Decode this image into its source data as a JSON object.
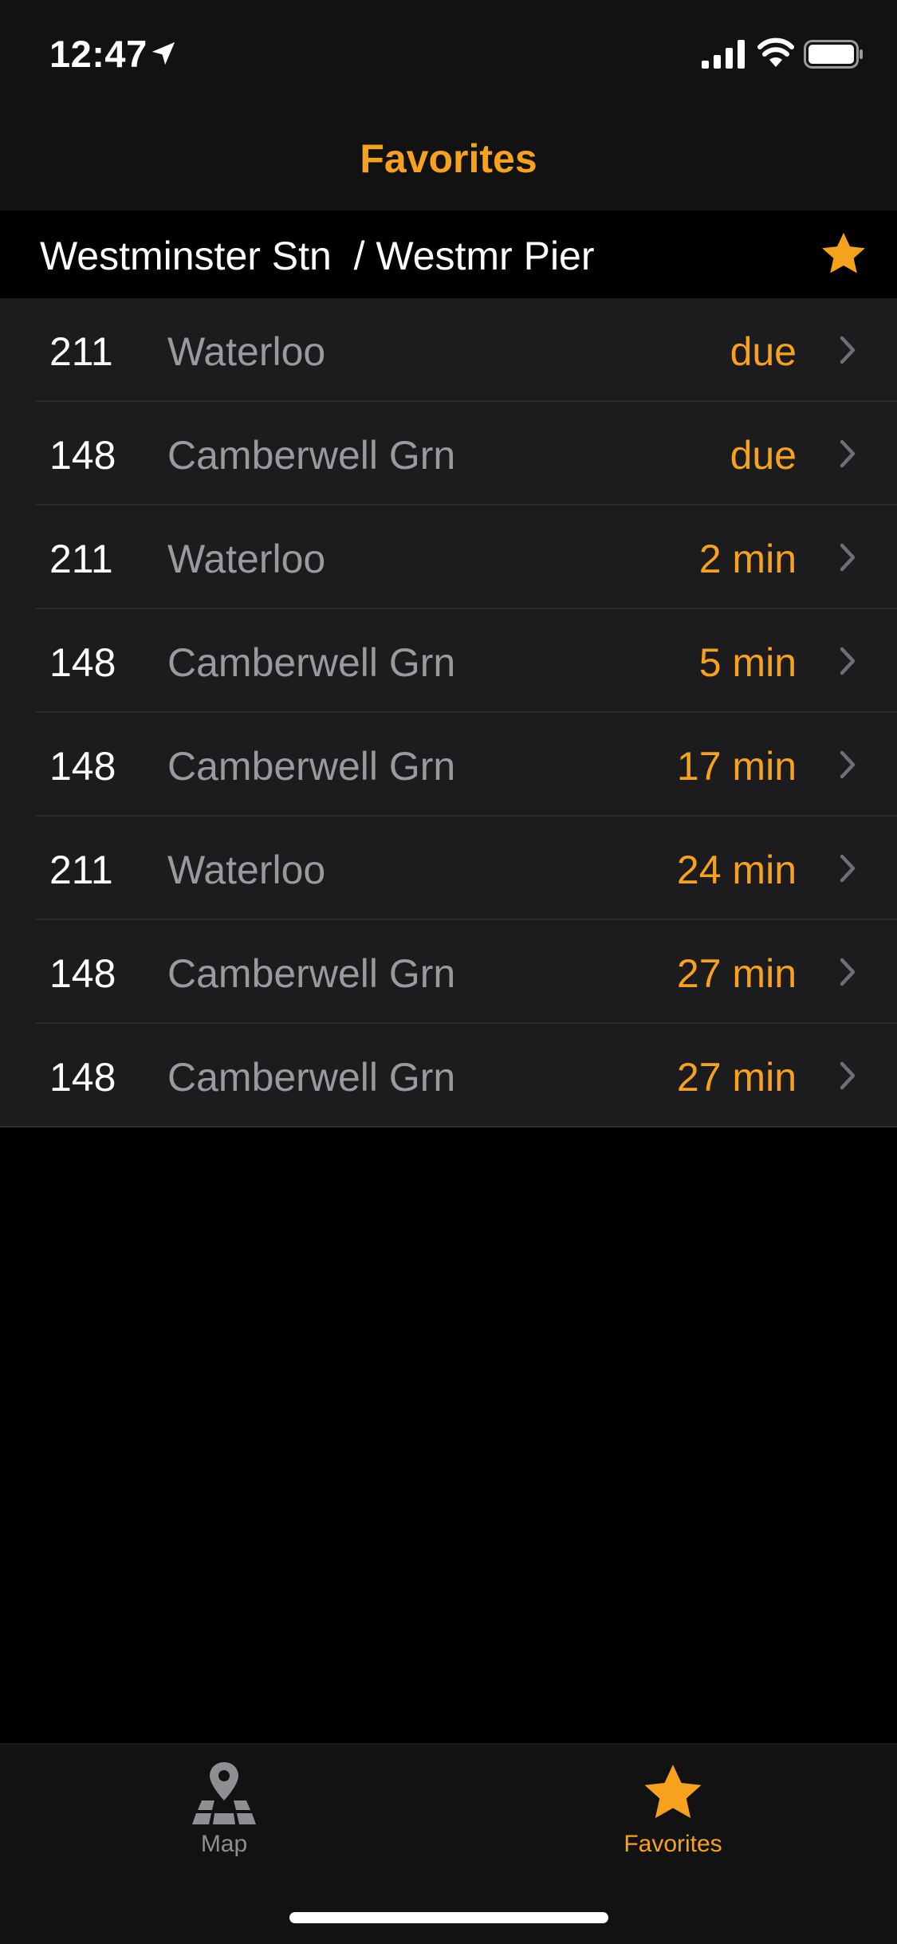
{
  "status_bar": {
    "time": "12:47"
  },
  "nav": {
    "title": "Favorites"
  },
  "section": {
    "title": "Westminster Stn  / Westmr Pier"
  },
  "arrivals": [
    {
      "route": "211",
      "destination": "Waterloo",
      "eta": "due"
    },
    {
      "route": "148",
      "destination": "Camberwell Grn",
      "eta": "due"
    },
    {
      "route": "211",
      "destination": "Waterloo",
      "eta": "2 min"
    },
    {
      "route": "148",
      "destination": "Camberwell Grn",
      "eta": "5 min"
    },
    {
      "route": "148",
      "destination": "Camberwell Grn",
      "eta": "17 min"
    },
    {
      "route": "211",
      "destination": "Waterloo",
      "eta": "24 min"
    },
    {
      "route": "148",
      "destination": "Camberwell Grn",
      "eta": "27 min"
    },
    {
      "route": "148",
      "destination": "Camberwell Grn",
      "eta": "27 min"
    }
  ],
  "tab_bar": {
    "map_label": "Map",
    "favorites_label": "Favorites",
    "selected": "favorites"
  },
  "colors": {
    "accent": "#f7a21c",
    "background": "#000000",
    "row_background": "#1c1c1e",
    "bar_background": "#121212",
    "secondary_text": "#9a9a9e"
  }
}
